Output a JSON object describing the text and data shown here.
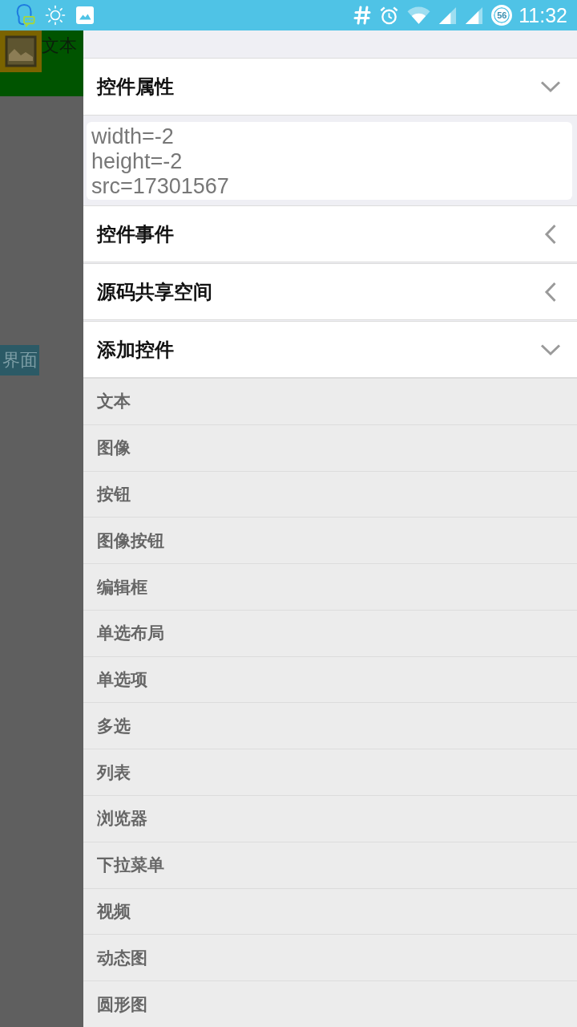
{
  "status_bar": {
    "battery": "56",
    "time": "11:32"
  },
  "canvas": {
    "text_widget": "文本",
    "screen_label": "界面"
  },
  "drawer": {
    "sections": [
      {
        "title": "控件属性",
        "expanded": true,
        "lines": [
          "width=-2",
          "height=-2",
          "src=17301567"
        ]
      },
      {
        "title": "控件事件",
        "expanded": false
      },
      {
        "title": "源码共享空间",
        "expanded": false
      },
      {
        "title": "添加控件",
        "expanded": true,
        "items": [
          "文本",
          "图像",
          "按钮",
          "图像按钮",
          "编辑框",
          "单选布局",
          "单选项",
          "多选",
          "列表",
          "浏览器",
          "下拉菜单",
          "视频",
          "动态图",
          "圆形图"
        ]
      }
    ]
  }
}
